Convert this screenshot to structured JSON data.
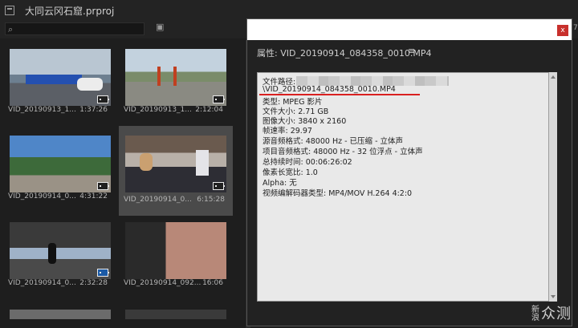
{
  "project": {
    "title": "大同云冈石窟.prproj",
    "search_placeholder": ""
  },
  "clips": [
    {
      "name": "VID_20190913_1...",
      "duration": "1:37:26",
      "selected": false
    },
    {
      "name": "VID_20190913_1...",
      "duration": "2:12:04",
      "selected": false
    },
    {
      "name": "VID_20190914_0...",
      "duration": "4:31:22",
      "selected": false
    },
    {
      "name": "VID_20190914_0...",
      "duration": "6:15:28",
      "selected": true
    },
    {
      "name": "VID_20190914_0...",
      "duration": "2:32:28",
      "selected": false
    },
    {
      "name": "VID_20190914_092...",
      "duration": "16:06",
      "selected": false
    }
  ],
  "properties": {
    "header": "属性: VID_20190914_084358_0010.MP4",
    "menu_icon": "≡",
    "close_label": "x",
    "lines": [
      "文件路径:",
      "\\VID_20190914_084358_0010.MP4",
      "类型: MPEG 影片",
      "文件大小: 2.71 GB",
      "图像大小: 3840 x 2160",
      "帧速率: 29.97",
      "源音频格式: 48000 Hz - 已压缩 - 立体声",
      "项目音频格式: 48000 Hz - 32 位浮点 - 立体声",
      "总持续时间: 00:06:26:02",
      "像素长宽比: 1.0",
      "Alpha: 无",
      "视频编解码器类型: MP4/MOV H.264 4:2:0"
    ]
  },
  "watermark": {
    "small": "新浪",
    "big": "众测"
  },
  "edge_digit": "7",
  "colors": {
    "accent_red": "#d92020",
    "selected": "#4a4a4a"
  }
}
